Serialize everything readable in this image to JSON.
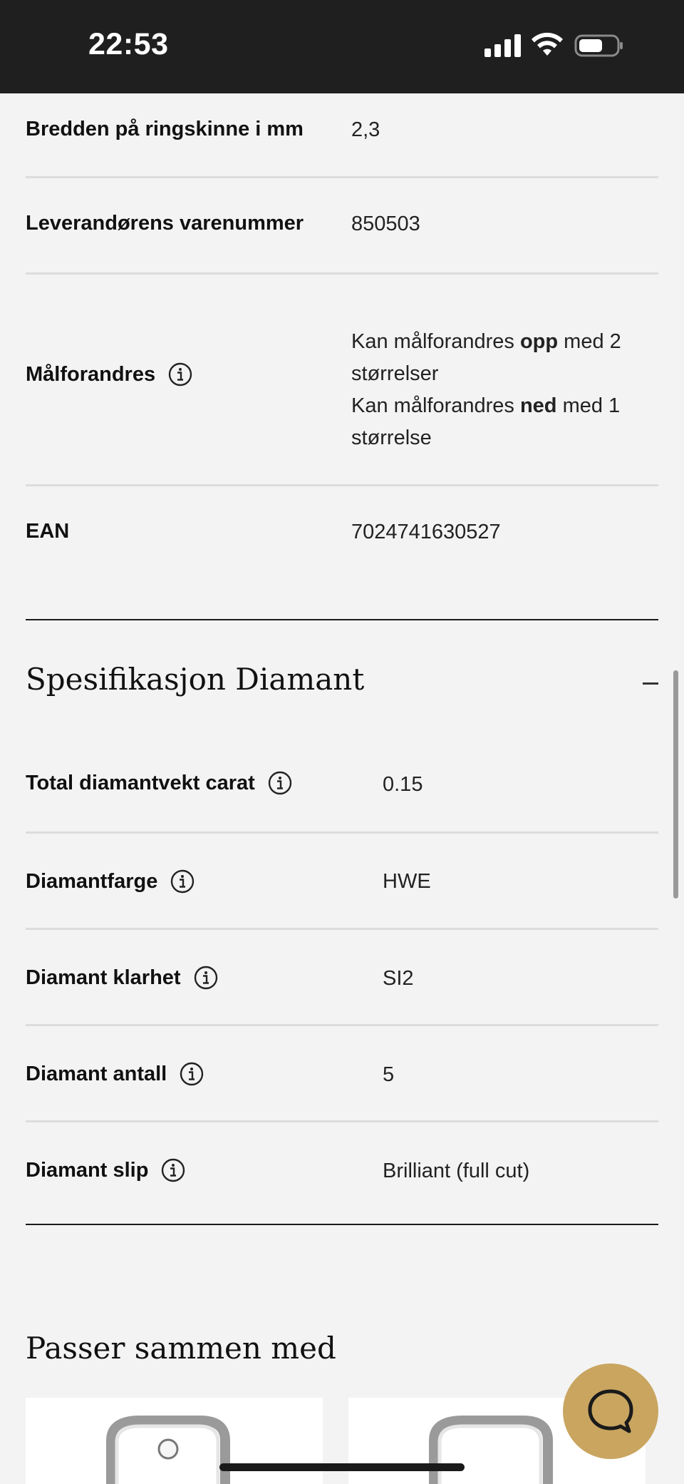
{
  "status_bar": {
    "time": "22:53"
  },
  "spec_rows_top": [
    {
      "label": "Bredden på ringskinne i mm",
      "value": "2,3"
    },
    {
      "label": "Leverandørens varenummer",
      "value": "850503"
    },
    {
      "label": "Målforandres",
      "value_line1_pre": "Kan målforandres ",
      "value_line1_bold": "opp",
      "value_line1_post": " med 2",
      "value_line2": "størrelser",
      "value_line3_pre": "Kan målforandres ",
      "value_line3_bold": "ned",
      "value_line3_post": " med 1",
      "value_line4": "størrelse"
    },
    {
      "label": "EAN",
      "value": "7024741630527"
    }
  ],
  "diamond_section": {
    "title": "Spesifikasjon Diamant",
    "toggle": "–",
    "rows": [
      {
        "label": "Total diamantvekt carat",
        "value": "0.15"
      },
      {
        "label": "Diamantfarge",
        "value": "HWE"
      },
      {
        "label": "Diamant klarhet",
        "value": "SI2"
      },
      {
        "label": "Diamant antall",
        "value": "5"
      },
      {
        "label": "Diamant slip",
        "value": "Brilliant (full cut)"
      }
    ]
  },
  "related_section": {
    "title": "Passer sammen med"
  },
  "icons": {
    "info": "info-icon",
    "chat": "chat-bubble-icon"
  },
  "colors": {
    "status_bar": "#1f1f1f",
    "background": "#f3f3f3",
    "chat_button": "#c9a560"
  }
}
